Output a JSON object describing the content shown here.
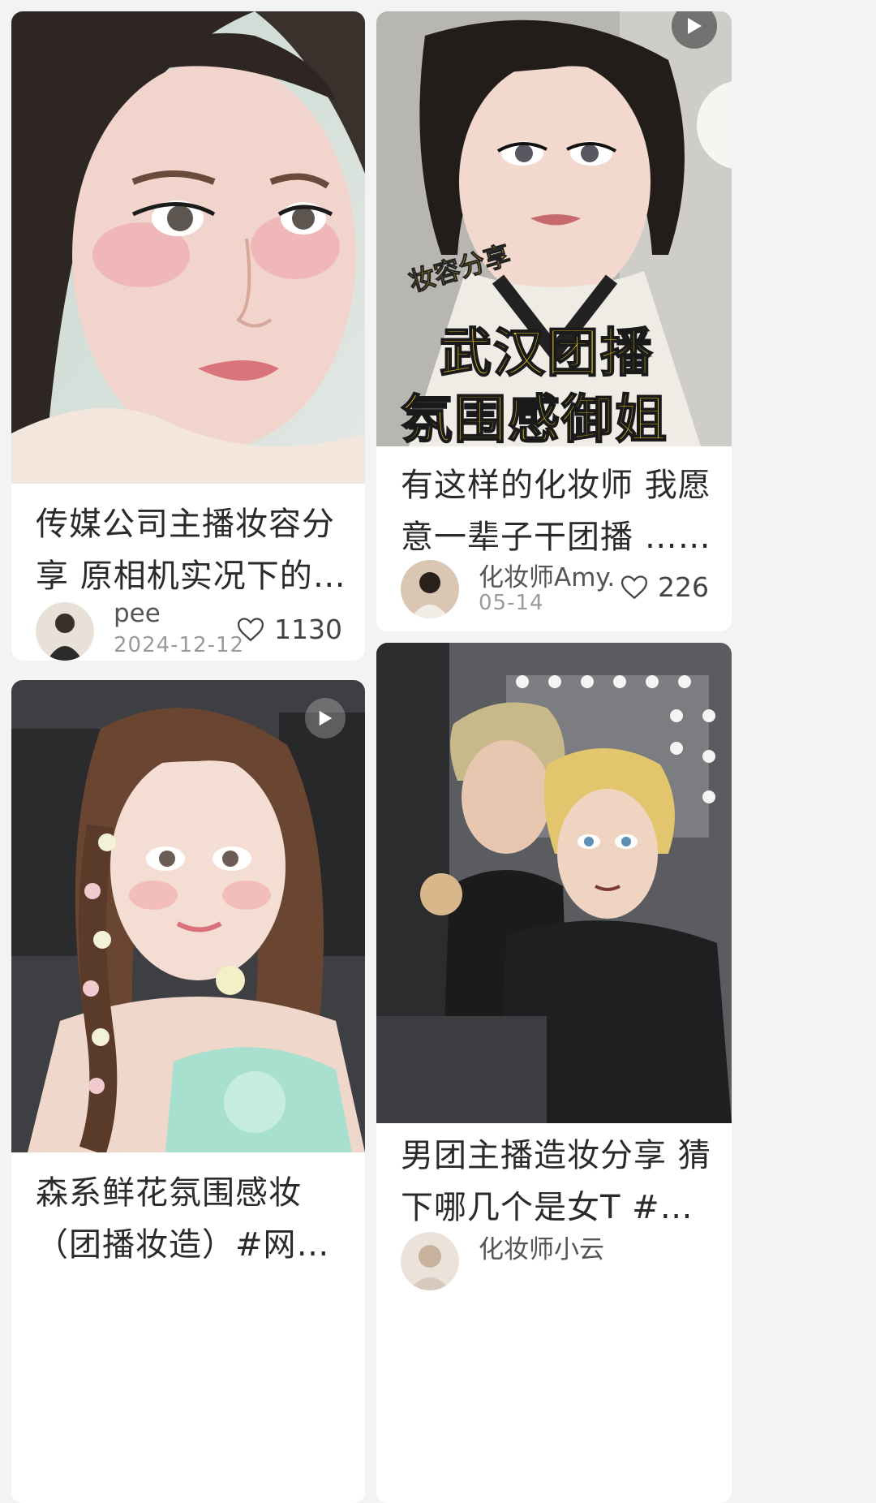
{
  "feed": {
    "cards": [
      {
        "title": "传媒公司主播妆容分享 原相机实况下的妆面…",
        "author": "pee",
        "date": "2024-12-12",
        "likes": "1130",
        "has_video": false
      },
      {
        "title": "有这样的化妆师 我愿意一辈子干团播 ……",
        "author": "化妆师Amy.",
        "date": "05-14",
        "likes": "226",
        "has_video": true,
        "overlay": {
          "tag": "妆容分享",
          "line1": "武汉团播",
          "line2": "氛围感御姐"
        }
      },
      {
        "title": "森系鲜花氛围感妆（团播妆造）#网感妆容 …",
        "has_video": true
      },
      {
        "title": "男团主播造妆分享 猜下哪几个是女T #团…",
        "author": "化妆师小云",
        "has_video": false
      }
    ]
  },
  "colors": {
    "background": "#f3f3f3",
    "card": "#ffffff",
    "overlay_yellow": "#f5d21f",
    "text": "#2a2a2a",
    "muted": "#9a9a9a"
  }
}
